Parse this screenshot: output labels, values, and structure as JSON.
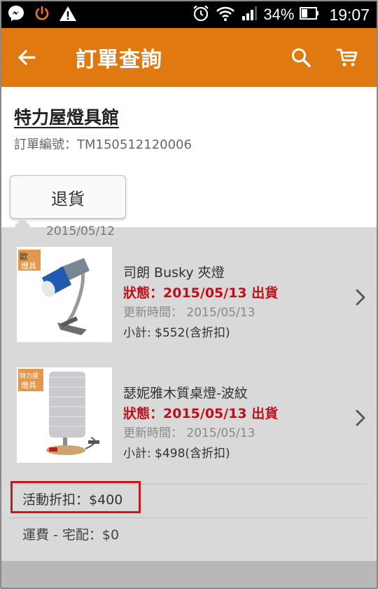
{
  "statusbar": {
    "battery": "34%",
    "time": "19:07"
  },
  "appbar": {
    "title": "訂單查詢"
  },
  "store": {
    "name": "特力屋燈具館",
    "order_number": "訂單編號：TM150512120006"
  },
  "actions": {
    "return_label": "退貨"
  },
  "order": {
    "date": "2015/05/12"
  },
  "items": [
    {
      "name": "司朗 Busky 夾燈",
      "status": "狀態：2015/05/13 出貨",
      "updated": "更新時間： 2015/05/13",
      "subtotal": "小計: $552(含折扣)",
      "badge": "歐\n燈具"
    },
    {
      "name": "瑟妮雅木質桌燈-波紋",
      "status": "狀態：2015/05/13 出貨",
      "updated": "更新時間： 2015/05/13",
      "subtotal": "小計: $498(含折扣)",
      "badge": "特力屋\n燈具"
    }
  ],
  "summary": {
    "discount": "活動折扣：$400",
    "shipping": "運費 - 宅配：$0"
  },
  "colors": {
    "accent": "#e07a10",
    "status_red": "#c0101a",
    "highlight_red": "#c41a1a"
  },
  "icons": {
    "messenger": "messenger-icon",
    "power": "power-icon",
    "warning": "warning-icon",
    "alarm": "alarm-icon",
    "wifi": "wifi-icon",
    "signal": "signal-icon",
    "battery": "battery-icon",
    "back": "back-arrow-icon",
    "search": "search-icon",
    "cart": "cart-icon",
    "chevron": "chevron-right-icon"
  }
}
